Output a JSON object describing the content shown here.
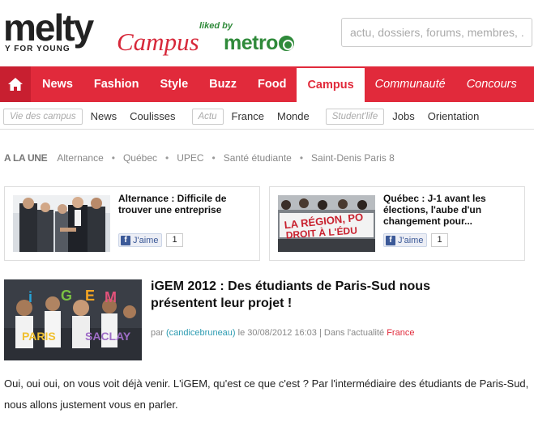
{
  "header": {
    "logo_main": "melty",
    "logo_tagline": "Y FOR YOUNG",
    "logo_section": "Campus",
    "partner_label": "liked by",
    "partner_name": "metro",
    "search_placeholder": "actu, dossiers, forums, membres, ..."
  },
  "main_nav": {
    "items": [
      {
        "label": "News",
        "active": false
      },
      {
        "label": "Fashion",
        "active": false
      },
      {
        "label": "Style",
        "active": false
      },
      {
        "label": "Buzz",
        "active": false
      },
      {
        "label": "Food",
        "active": false
      },
      {
        "label": "Campus",
        "active": true
      },
      {
        "label": "Communauté",
        "active": false
      },
      {
        "label": "Concours",
        "active": false
      }
    ]
  },
  "sub_nav": {
    "tag1": "Vie des campus",
    "links1": [
      "News",
      "Coulisses"
    ],
    "tag2": "Actu",
    "links2": [
      "France",
      "Monde"
    ],
    "tag3": "Student'life",
    "links3": [
      "Jobs",
      "Orientation"
    ]
  },
  "a_la_une": {
    "title": "A LA UNE",
    "topics": [
      "Alternance",
      "Québec",
      "UPEC",
      "Santé étudiante",
      "Saint-Denis Paris 8"
    ]
  },
  "cards": [
    {
      "title": "Alternance : Difficile de trouver une entreprise",
      "like_label": "J'aime",
      "like_count": "1"
    },
    {
      "title": "Québec : J-1 avant les élections, l'aube d'un changement pour...",
      "like_label": "J'aime",
      "like_count": "1"
    }
  ],
  "article": {
    "title": "iGEM 2012 : Des étudiants de Paris-Sud nous présentent leur projet !",
    "meta_prefix": "par",
    "author": "(candicebruneau)",
    "meta_date": "le 30/08/2012 16:03 | Dans l'actualité",
    "category": "France",
    "body": "Oui, oui oui, on vous voit déjà venir. L'iGEM, qu'est ce que c'est ? Par l'intermédiaire des étudiants de Paris-Sud, nous allons justement vous en parler."
  },
  "colors": {
    "brand_red": "#e12a3b",
    "metro_green": "#2f8a3a",
    "author_link": "#2b9bb1"
  }
}
